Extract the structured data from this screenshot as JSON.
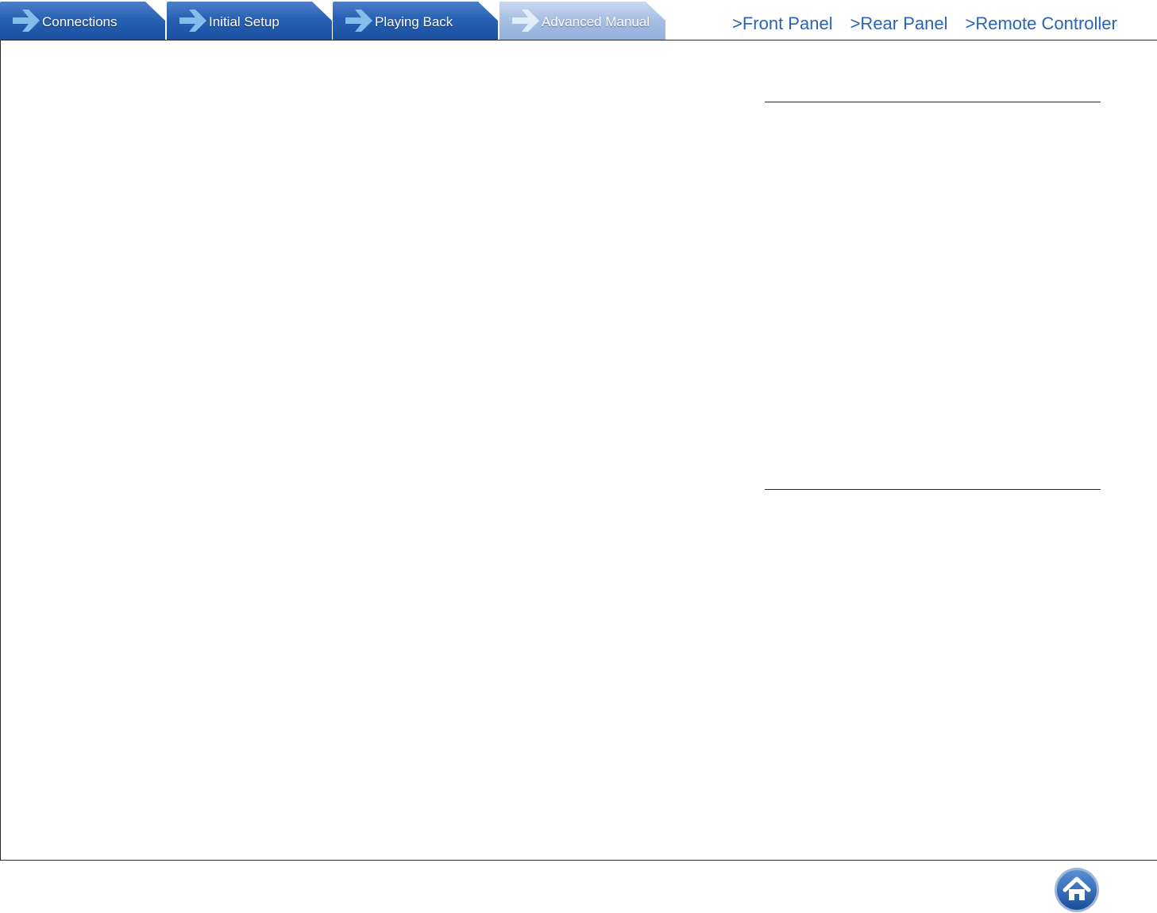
{
  "nav": {
    "tabs": [
      {
        "label": "Connections",
        "active": false
      },
      {
        "label": "Initial Setup",
        "active": false
      },
      {
        "label": "Playing Back",
        "active": false
      },
      {
        "label": "Advanced Manual",
        "active": true
      }
    ],
    "links": [
      {
        "label": ">Front Panel"
      },
      {
        "label": ">Rear Panel"
      },
      {
        "label": ">Remote Controller"
      }
    ]
  },
  "home": {
    "icon": "home-icon"
  },
  "colors": {
    "tab_blue": "#1a4fa0",
    "tab_active": "#a9c0e4",
    "link_blue": "#2b63b6",
    "home_blue": "#1f5aa8"
  }
}
